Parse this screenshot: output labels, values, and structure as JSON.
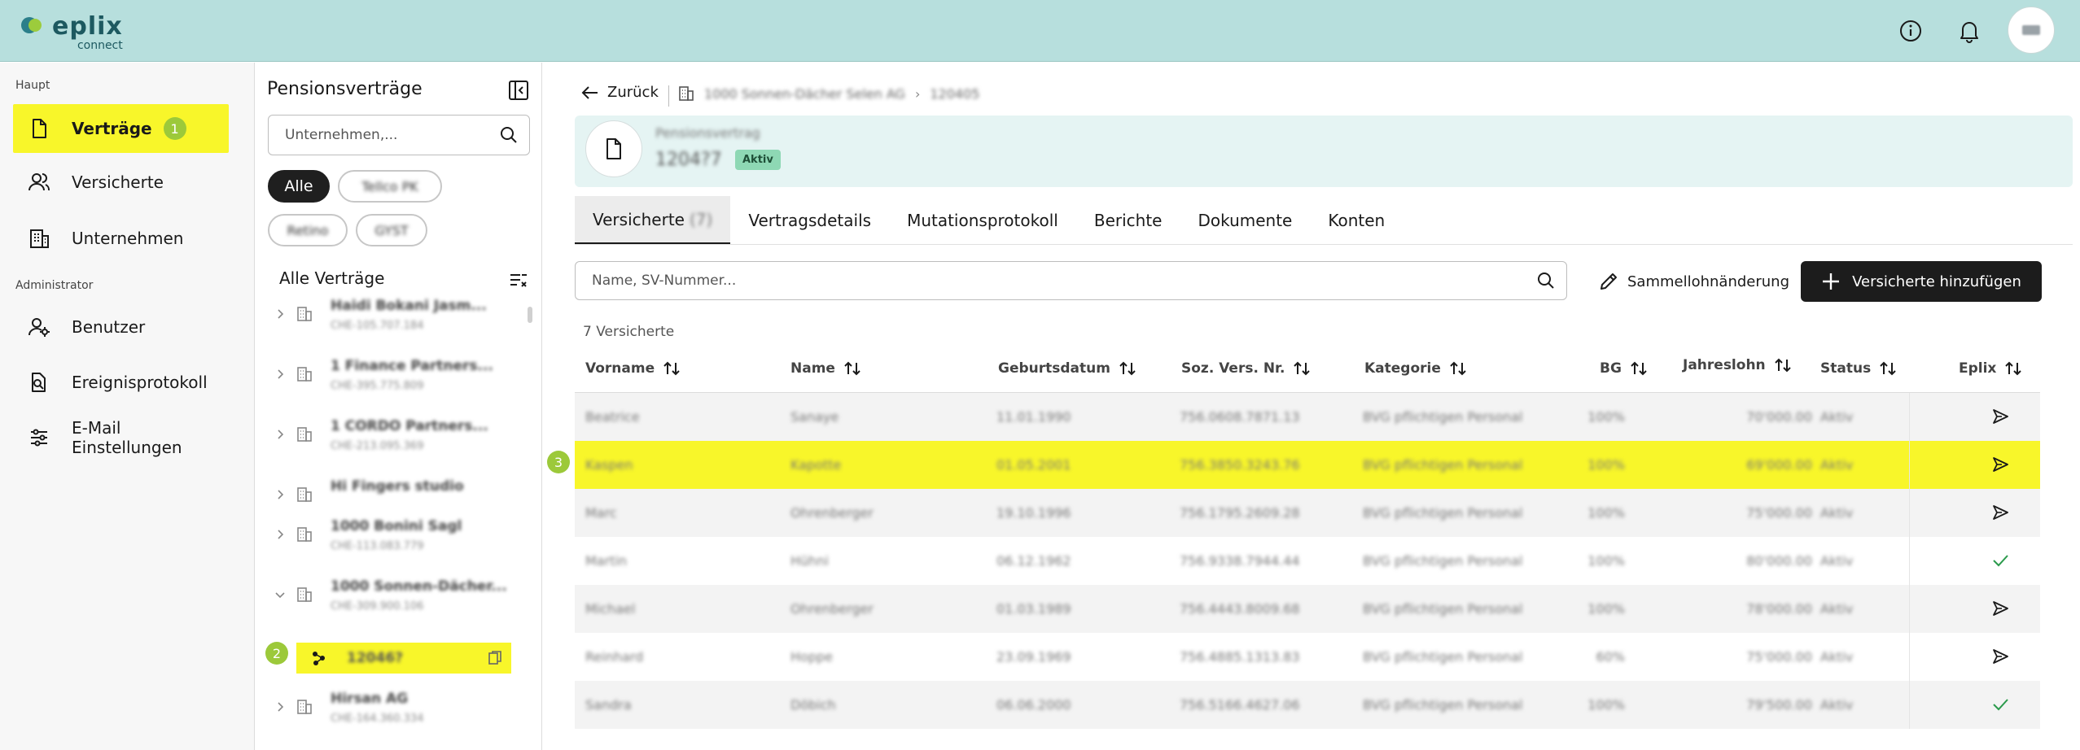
{
  "header": {
    "brand_name": "eplix",
    "brand_sub": "connect",
    "icons": [
      "info-icon",
      "bell-icon",
      "avatar"
    ]
  },
  "leftnav": {
    "section_main": "Haupt",
    "section_admin": "Administrator",
    "items": [
      {
        "label": "Verträge",
        "icon": "document-icon",
        "badge": "1",
        "active": true
      },
      {
        "label": "Versicherte",
        "icon": "users-icon"
      },
      {
        "label": "Unternehmen",
        "icon": "building-icon"
      },
      {
        "label": "Benutzer",
        "icon": "user-settings-icon"
      },
      {
        "label": "Ereignisprotokoll",
        "icon": "search-document-icon"
      },
      {
        "label": "E-Mail Einstellungen",
        "icon": "sliders-icon"
      }
    ]
  },
  "panel": {
    "title": "Pensionsverträge",
    "search_placeholder": "Unternehmen,...",
    "chips": [
      "Alle",
      "Tellco PK",
      "Retino",
      "GYST"
    ],
    "list_title": "Alle Verträge",
    "tree": [
      {
        "name": "Haidi Bokani Jasm...",
        "sub": "CHE-105.707.184"
      },
      {
        "name": "1 Finance Partners...",
        "sub": "CHE-395.775.809"
      },
      {
        "name": "1 CORDO Partners...",
        "sub": "CHE-213.095.369"
      },
      {
        "name": "Hi Fingers studio",
        "sub": ""
      },
      {
        "name": "1000 Bonini Sagl",
        "sub": "CHE-113.083.779"
      },
      {
        "name": "1000 Sonnen-Dächer...",
        "sub": "CHE-309.900.106"
      },
      {
        "name": "Hirsan AG",
        "sub": "CHE-164.360.334"
      }
    ],
    "selected_contract": "12046?",
    "step_badge": "2"
  },
  "main": {
    "back_label": "Zurück",
    "breadcrumb_company": "1000 Sonnen-Dächer Selen AG",
    "breadcrumb_contract": "120405",
    "banner_kind": "Pensionsvertrag",
    "banner_number": "1204?7",
    "status": "Aktiv",
    "tabs": [
      {
        "label": "Versicherte",
        "count": "(7)"
      },
      {
        "label": "Vertragsdetails",
        "count": ""
      },
      {
        "label": "Mutationsprotokoll",
        "count": ""
      },
      {
        "label": "Berichte",
        "count": ""
      },
      {
        "label": "Dokumente",
        "count": ""
      },
      {
        "label": "Konten",
        "count": ""
      }
    ],
    "search_placeholder": "Name, SV-Nummer...",
    "sammel_label": "Sammellohnänderung",
    "add_label": "Versicherte hinzufügen",
    "table_caption": "7 Versicherte",
    "columns": [
      "Vorname",
      "Name",
      "Geburtsdatum",
      "Soz. Vers. Nr.",
      "Kategorie",
      "BG",
      "Jahreslohn",
      "Status",
      "Eplix"
    ],
    "rows": [
      {
        "vorname": "Beatrice",
        "name": "Sanaye",
        "geburt": "11.01.1990",
        "sv": "756.0608.7871.13",
        "kategorie": "BVG pflichtigen Personal",
        "bg": "100%",
        "lohn": "70'000.00",
        "status": "Aktiv",
        "eplix": "send"
      },
      {
        "vorname": "Kaspen",
        "name": "Kapotte",
        "geburt": "01.05.2001",
        "sv": "756.3850.3243.76",
        "kategorie": "BVG pflichtigen Personal",
        "bg": "100%",
        "lohn": "69'000.00",
        "status": "Aktiv",
        "eplix": "send"
      },
      {
        "vorname": "Marc",
        "name": "Ohrenberger",
        "geburt": "19.10.1996",
        "sv": "756.1795.2609.28",
        "kategorie": "BVG pflichtigen Personal",
        "bg": "100%",
        "lohn": "75'000.00",
        "status": "Aktiv",
        "eplix": "send"
      },
      {
        "vorname": "Martin",
        "name": "Hühni",
        "geburt": "06.12.1962",
        "sv": "756.9338.7944.44",
        "kategorie": "BVG pflichtigen Personal",
        "bg": "100%",
        "lohn": "80'000.00",
        "status": "Aktiv",
        "eplix": "check"
      },
      {
        "vorname": "Michael",
        "name": "Ohrenberger",
        "geburt": "01.03.1989",
        "sv": "756.4443.8009.68",
        "kategorie": "BVG pflichtigen Personal",
        "bg": "100%",
        "lohn": "78'000.00",
        "status": "Aktiv",
        "eplix": "send"
      },
      {
        "vorname": "Reinhard",
        "name": "Hoppe",
        "geburt": "23.09.1969",
        "sv": "756.4885.1313.83",
        "kategorie": "BVG pflichtigen Personal",
        "bg": "60%",
        "lohn": "75'000.00",
        "status": "Aktiv",
        "eplix": "send"
      },
      {
        "vorname": "Sandra",
        "name": "Döbich",
        "geburt": "06.06.2000",
        "sv": "756.5166.4627.06",
        "kategorie": "BVG pflichtigen Personal",
        "bg": "100%",
        "lohn": "79'500.00",
        "status": "Aktiv",
        "eplix": "check"
      }
    ],
    "step_badge": "3"
  }
}
